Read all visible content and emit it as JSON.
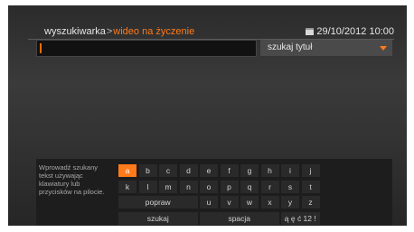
{
  "header": {
    "breadcrumb_root": "wyszukiwarka",
    "breadcrumb_sep": ">",
    "breadcrumb_current": "wideo na życzenie",
    "datetime": "29/10/2012 10:00"
  },
  "search": {
    "value": ""
  },
  "mode": {
    "selected": "szukaj tytuł"
  },
  "keyboard": {
    "help": "Wprowadź szukany tekst używając klawiatury lub przycisków na pilocie.",
    "row1": [
      "a",
      "b",
      "c",
      "d",
      "e",
      "f",
      "g",
      "h",
      "i",
      "j"
    ],
    "row2": [
      "k",
      "l",
      "m",
      "n",
      "o",
      "p",
      "q",
      "r",
      "s",
      "t"
    ],
    "row3_label": "popraw",
    "row3": [
      "u",
      "v",
      "w",
      "x",
      "y",
      "z"
    ],
    "search_label": "szukaj",
    "space_label": "spacja",
    "special_label": "ą ę ć 12 !"
  },
  "colors": {
    "accent": "#ff7a1a",
    "background": "#333333"
  },
  "icons": {
    "calendar": "calendar-icon",
    "dropdown": "dropdown-arrow-icon"
  }
}
